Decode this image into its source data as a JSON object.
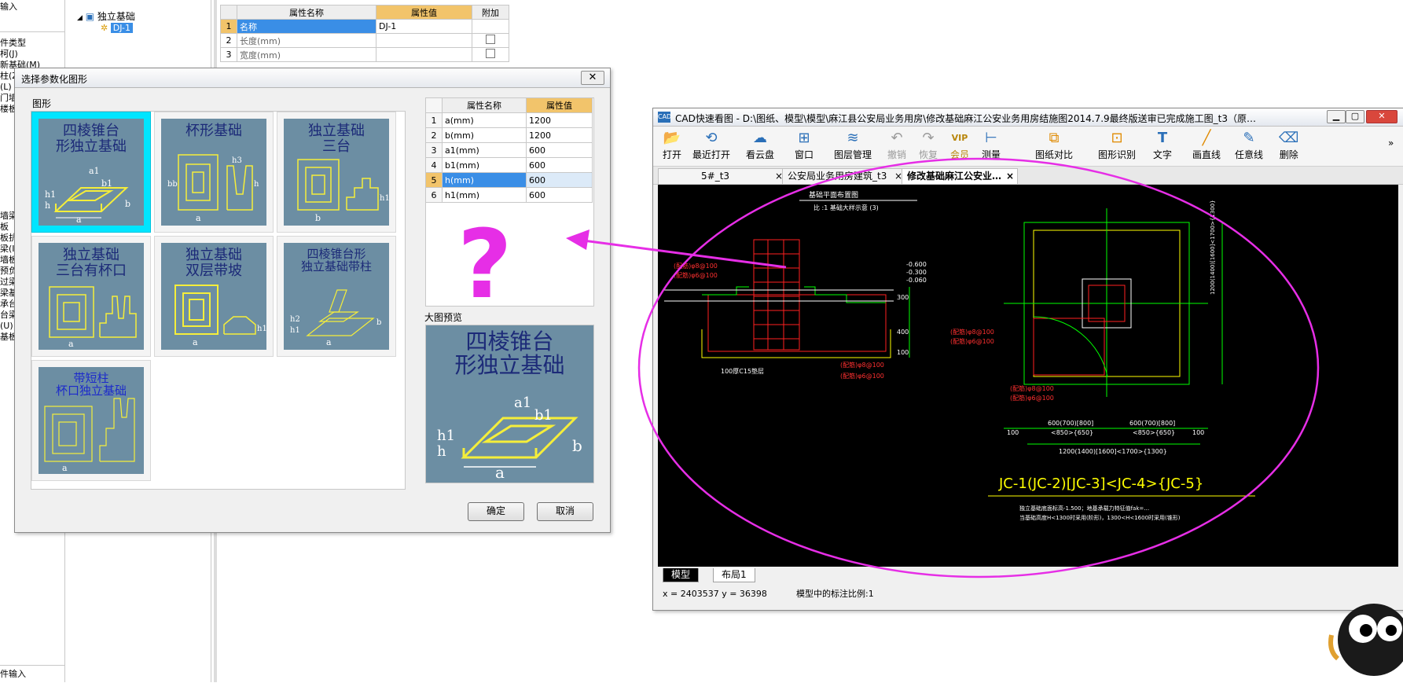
{
  "background": {
    "left_top_label": "输入",
    "left_cut_items": [
      "件类型",
      "柯(J)",
      "新基础(M)",
      "柱(Z)",
      "(L)",
      "门墙",
      "楼板"
    ],
    "left_cut_items2": [
      "墙梁",
      "板",
      "板抗",
      "梁(I)",
      "墙板",
      "预负",
      "过梁",
      "梁基",
      "承台",
      "台梁",
      "(U)",
      "基板"
    ],
    "bottom_label": "件输入",
    "tree_root": "独立基础",
    "tree_child": "DJ-1",
    "prop_table": {
      "header_name": "属性名称",
      "header_value": "属性值",
      "header_extra": "附加",
      "rows": [
        {
          "num": "1",
          "name": "名称",
          "value": "DJ-1"
        },
        {
          "num": "2",
          "name": "长度(mm)",
          "value": ""
        },
        {
          "num": "3",
          "name": "宽度(mm)",
          "value": ""
        }
      ]
    }
  },
  "dialog": {
    "title": "选择参数化图形",
    "close_label": "✕",
    "group_label": "图形",
    "shapes": [
      {
        "label_line1": "四棱锥台",
        "label_line2": "形独立基础"
      },
      {
        "label_line1": "杯形基础",
        "label_line2": ""
      },
      {
        "label_line1": "独立基础",
        "label_line2": "三台"
      },
      {
        "label_line1": "独立基础",
        "label_line2": "三台有杯口"
      },
      {
        "label_line1": "独立基础",
        "label_line2": "双层带坡"
      },
      {
        "label_line1": "四棱锥台形",
        "label_line2": "独立基础带柱"
      },
      {
        "label_line1": "带短柱",
        "label_line2": "杯口独立基础"
      }
    ],
    "param_table": {
      "header_name": "属性名称",
      "header_value": "属性值",
      "rows": [
        {
          "num": "1",
          "name": "a(mm)",
          "value": "1200"
        },
        {
          "num": "2",
          "name": "b(mm)",
          "value": "1200"
        },
        {
          "num": "3",
          "name": "a1(mm)",
          "value": "600"
        },
        {
          "num": "4",
          "name": "b1(mm)",
          "value": "600"
        },
        {
          "num": "5",
          "name": "h(mm)",
          "value": "600"
        },
        {
          "num": "6",
          "name": "h1(mm)",
          "value": "600"
        }
      ]
    },
    "preview_label": "大图预览",
    "preview_line1": "四棱锥台",
    "preview_line2": "形独立基础",
    "ok_label": "确定",
    "cancel_label": "取消"
  },
  "cad": {
    "title": "CAD快速看图 - D:\\图纸、模型\\模型\\麻江县公安局业务用房\\修改基础麻江公安业务用房结施图2014.7.9最终版送审已完成施工图_t3（原…",
    "app_icon": "CAD",
    "toolbar": [
      {
        "label": "打开",
        "icon": "📂"
      },
      {
        "label": "最近打开",
        "icon": "⟲"
      },
      {
        "label": "看云盘",
        "icon": "☁"
      },
      {
        "label": "窗口",
        "icon": "⊞"
      },
      {
        "label": "图层管理",
        "icon": "≋"
      },
      {
        "label": "撤销",
        "icon": "↶"
      },
      {
        "label": "恢复",
        "icon": "↷"
      },
      {
        "label": "会员",
        "icon": "VIP"
      },
      {
        "label": "测量",
        "icon": "⊢"
      },
      {
        "label": "图纸对比",
        "icon": "⧉"
      },
      {
        "label": "图形识别",
        "icon": "⊡"
      },
      {
        "label": "文字",
        "icon": "T"
      },
      {
        "label": "画直线",
        "icon": "╱"
      },
      {
        "label": "任意线",
        "icon": "✎"
      },
      {
        "label": "删除",
        "icon": "⌫"
      }
    ],
    "more_label": "»",
    "tabs": [
      {
        "label": "5#_t3"
      },
      {
        "label": "公安局业务用房建筑_t3"
      },
      {
        "label": "修改基础麻江公安业…"
      }
    ],
    "tab_close": "×",
    "drawing": {
      "section_title": "基础平面布置图",
      "section_sub": "比 :1     基础大样示意      (3)",
      "plan_caption": "JC-1(JC-2)[JC-3]<JC-4>{JC-5}",
      "note1": "独立基础底面标高-1.500；地基承载力特征值fak=…",
      "note2": "当基础高度H<1300时采用(阶形)，1300<H<1600时采用(锥形)",
      "elev1": "-0.600",
      "elev2": "-0.300",
      "elev3": "-0.060",
      "dim1": "600(700)[800]",
      "dim2": "<850>{650}",
      "dim3": "1200(1400)[1600]<1700>{1300}",
      "dim_100": "100",
      "dim_300": "300",
      "dim_400": "400",
      "rebar1": "(配筋)φ8@100",
      "rebar2": "(配筋)φ6@100",
      "cushion": "100厚C15垫层",
      "side_dim": "1200(1400)[1600]<1700>{1300}"
    },
    "layout_tabs": [
      "模型",
      "布局1"
    ],
    "status_coords": "x = 2403537  y = 36398",
    "status_scale": "模型中的标注比例:1"
  },
  "annotation": {
    "question_mark": "?",
    "ellipse_color": "#e62ee6",
    "arrow_color": "#e62ee6"
  }
}
